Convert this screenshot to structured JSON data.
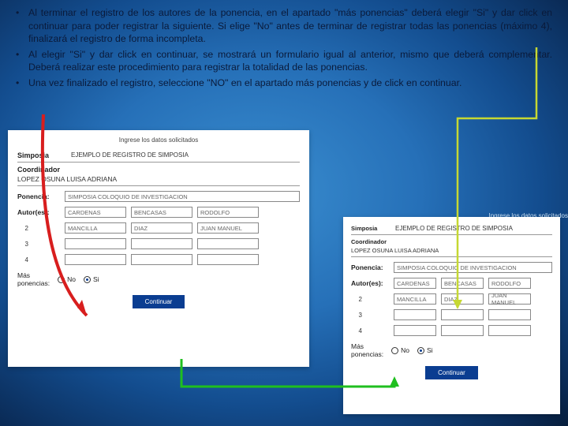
{
  "bullets": {
    "b1": "Al terminar el registro de los autores de la ponencia, en el apartado \"más ponencias\" deberá elegir \"Si\" y dar click en continuar para poder registrar la siguiente. Si elige \"No\" antes de terminar de registrar todas las ponencias (máximo 4), finalizará el registro de forma incompleta.",
    "b2": "Al elegir \"Si\" y dar click en continuar, se mostrará un formulario igual al anterior, mismo que deberá complementar. Deberá realizar este procedimiento para registrar la totalidad de las ponencias.",
    "b3": "Una vez finalizado el registro, seleccione \"NO\" en el apartado más ponencias y de click en continuar."
  },
  "form": {
    "header": "Ingrese los datos solicitados",
    "section_title": "Simposia",
    "section_sub": "EJEMPLO DE REGISTRO DE SIMPOSIA",
    "coord_label": "Coordinador",
    "coord_name": "LOPEZ OSUNA LUISA ADRIANA",
    "ponencia_label": "Ponencia:",
    "ponencia_value": "SIMPOSIA COLOQUIO DE INVESTIGACION",
    "autores_label": "Autor(es):",
    "rows": [
      {
        "a": "CARDENAS",
        "b": "BENCASAS",
        "c": "RODOLFO"
      },
      {
        "a": "MANCILLA",
        "b": "DIAZ",
        "c": "JUAN MANUEL"
      },
      {
        "a": "",
        "b": "",
        "c": ""
      },
      {
        "a": "",
        "b": "",
        "c": ""
      }
    ],
    "row_nums": {
      "n2": "2",
      "n3": "3",
      "n4": "4"
    },
    "mas_label": "Más",
    "mas_sub": "ponencias:",
    "opt_no": "No",
    "opt_si": "Si",
    "btn": "Continuar"
  },
  "tag": "Ingrese los datos solicitados"
}
